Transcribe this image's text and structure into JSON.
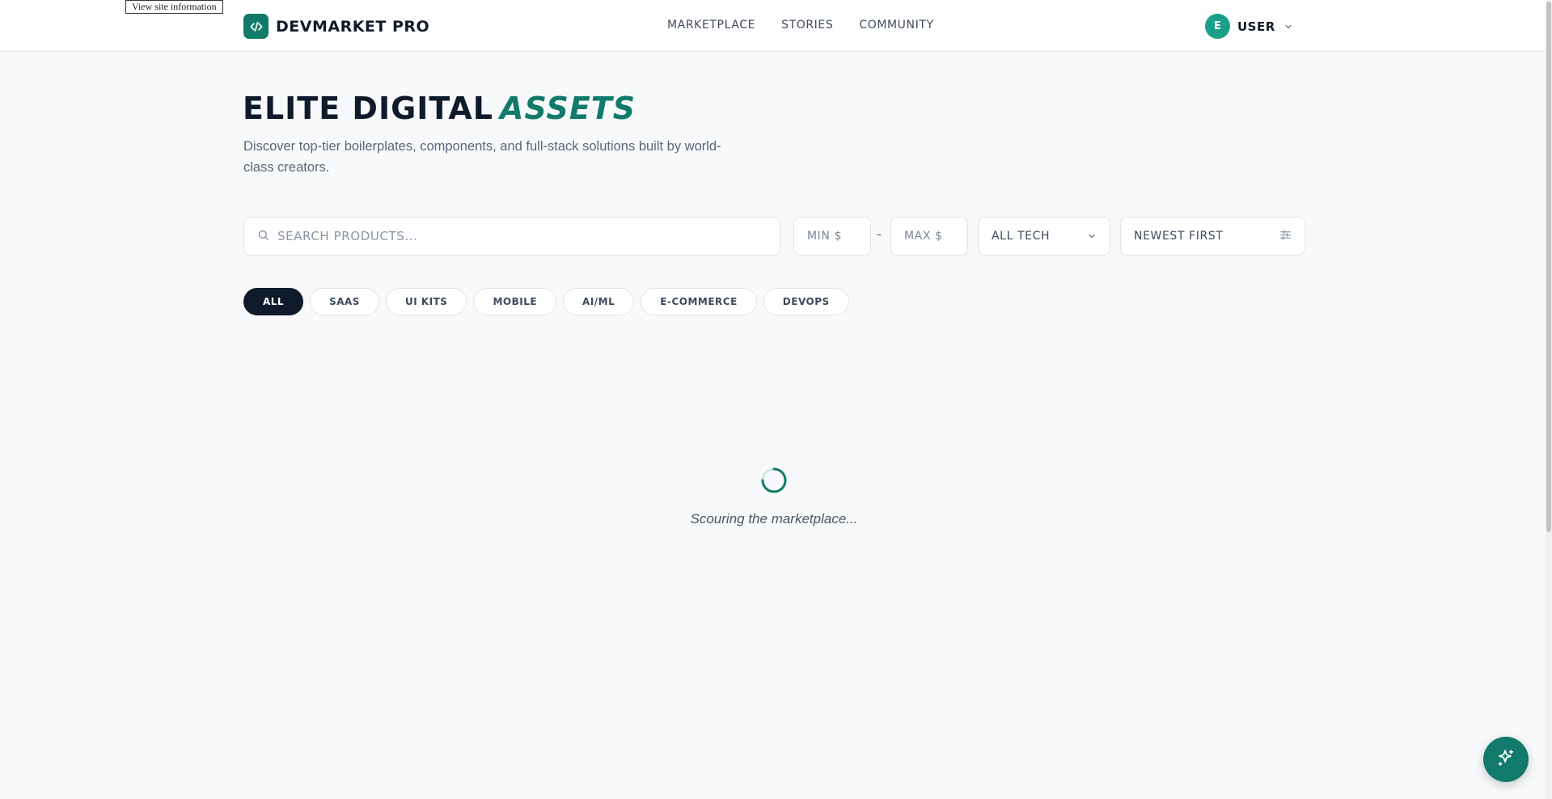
{
  "tooltip": {
    "text": "View site information"
  },
  "header": {
    "brand": {
      "name": "DEVMARKET PRO",
      "icon": "code-brackets-icon"
    },
    "nav": [
      {
        "label": "MARKETPLACE"
      },
      {
        "label": "STORIES"
      },
      {
        "label": "COMMUNITY"
      }
    ],
    "user": {
      "avatar_letter": "E",
      "label": "USER",
      "icon": "chevron-down-icon"
    }
  },
  "hero": {
    "title": "ELITE DIGITAL",
    "title_accent": "ASSETS",
    "subtitle": "Discover top-tier boilerplates, components, and full-stack solutions built by world-class creators."
  },
  "filters": {
    "search": {
      "placeholder": "SEARCH PRODUCTS...",
      "value": ""
    },
    "min_price": {
      "placeholder": "MIN $",
      "value": ""
    },
    "separator": "-",
    "max_price": {
      "placeholder": "MAX $",
      "value": ""
    },
    "tech": {
      "value": "ALL TECH"
    },
    "sort": {
      "value": "NEWEST FIRST"
    }
  },
  "categories": [
    {
      "label": "ALL",
      "active": true
    },
    {
      "label": "SAAS",
      "active": false
    },
    {
      "label": "UI KITS",
      "active": false
    },
    {
      "label": "MOBILE",
      "active": false
    },
    {
      "label": "AI/ML",
      "active": false
    },
    {
      "label": "E-COMMERCE",
      "active": false
    },
    {
      "label": "DEVOPS",
      "active": false
    }
  ],
  "loading": {
    "text": "Scouring the marketplace..."
  },
  "fab": {
    "icon": "sparkles-icon"
  },
  "colors": {
    "accent": "#117a6a",
    "dark": "#0f1a2b",
    "background": "#f7f9fa"
  }
}
